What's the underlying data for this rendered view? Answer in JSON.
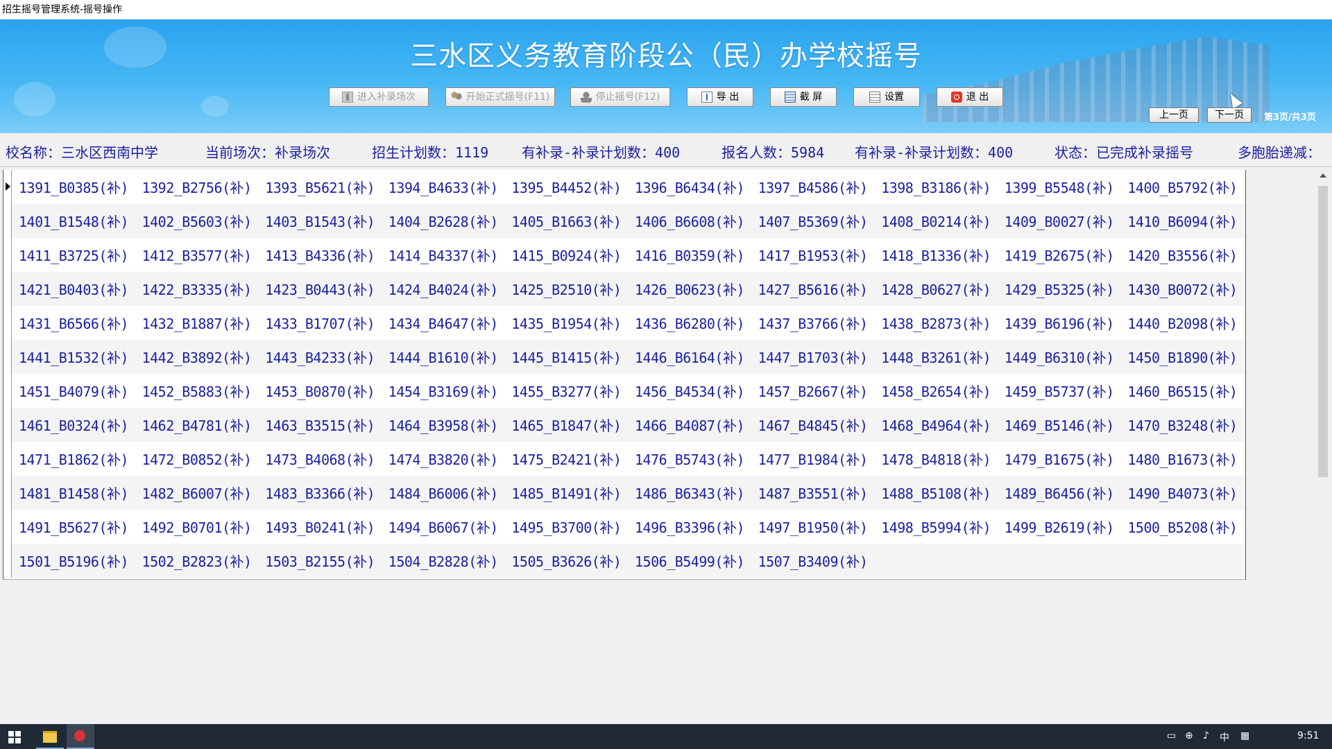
{
  "window": {
    "title": "招生摇号管理系统-摇号操作"
  },
  "header": {
    "title": "三水区义务教育阶段公（民）办学校摇号",
    "buttons": [
      {
        "label": "进入补录场次",
        "icon": "enter-icon",
        "enabled": false
      },
      {
        "label": "开始正式摇号(F11)",
        "icon": "people-icon",
        "enabled": false
      },
      {
        "label": "停止摇号(F12)",
        "icon": "user-stop-icon",
        "enabled": false
      },
      {
        "label": "导 出",
        "icon": "export-icon",
        "enabled": true
      },
      {
        "label": "截 屏",
        "icon": "screenshot-icon",
        "enabled": true
      },
      {
        "label": "设置",
        "icon": "settings-icon",
        "enabled": true
      },
      {
        "label": "退 出",
        "icon": "exit-icon",
        "enabled": true
      }
    ],
    "pager": {
      "prev_label": "上一页",
      "next_label": "下一页",
      "page_info": "第3页/共3页"
    }
  },
  "info": {
    "school": "校名称：三水区西南中学",
    "session": "当前场次：补录场次",
    "plan": "招生计划数：1119",
    "supp_plan": "有补录-补录计划数：400",
    "applicants": "报名人数：5984",
    "supp_plan2": "有补录-补录计划数：400",
    "status": "状态：已完成补录摇号",
    "twins": "多胞胎递减："
  },
  "results": [
    [
      "1391_B0385(补)",
      "1392_B2756(补)",
      "1393_B5621(补)",
      "1394_B4633(补)",
      "1395_B4452(补)",
      "1396_B6434(补)",
      "1397_B4586(补)",
      "1398_B3186(补)",
      "1399_B5548(补)",
      "1400_B5792(补)"
    ],
    [
      "1401_B1548(补)",
      "1402_B5603(补)",
      "1403_B1543(补)",
      "1404_B2628(补)",
      "1405_B1663(补)",
      "1406_B6608(补)",
      "1407_B5369(补)",
      "1408_B0214(补)",
      "1409_B0027(补)",
      "1410_B6094(补)"
    ],
    [
      "1411_B3725(补)",
      "1412_B3577(补)",
      "1413_B4336(补)",
      "1414_B4337(补)",
      "1415_B0924(补)",
      "1416_B0359(补)",
      "1417_B1953(补)",
      "1418_B1336(补)",
      "1419_B2675(补)",
      "1420_B3556(补)"
    ],
    [
      "1421_B0403(补)",
      "1422_B3335(补)",
      "1423_B0443(补)",
      "1424_B4024(补)",
      "1425_B2510(补)",
      "1426_B0623(补)",
      "1427_B5616(补)",
      "1428_B0627(补)",
      "1429_B5325(补)",
      "1430_B0072(补)"
    ],
    [
      "1431_B6566(补)",
      "1432_B1887(补)",
      "1433_B1707(补)",
      "1434_B4647(补)",
      "1435_B1954(补)",
      "1436_B6280(补)",
      "1437_B3766(补)",
      "1438_B2873(补)",
      "1439_B6196(补)",
      "1440_B2098(补)"
    ],
    [
      "1441_B1532(补)",
      "1442_B3892(补)",
      "1443_B4233(补)",
      "1444_B1610(补)",
      "1445_B1415(补)",
      "1446_B6164(补)",
      "1447_B1703(补)",
      "1448_B3261(补)",
      "1449_B6310(补)",
      "1450_B1890(补)"
    ],
    [
      "1451_B4079(补)",
      "1452_B5883(补)",
      "1453_B0870(补)",
      "1454_B3169(补)",
      "1455_B3277(补)",
      "1456_B4534(补)",
      "1457_B2667(补)",
      "1458_B2654(补)",
      "1459_B5737(补)",
      "1460_B6515(补)"
    ],
    [
      "1461_B0324(补)",
      "1462_B4781(补)",
      "1463_B3515(补)",
      "1464_B3958(补)",
      "1465_B1847(补)",
      "1466_B4087(补)",
      "1467_B4845(补)",
      "1468_B4964(补)",
      "1469_B5146(补)",
      "1470_B3248(补)"
    ],
    [
      "1471_B1862(补)",
      "1472_B0852(补)",
      "1473_B4068(补)",
      "1474_B3820(补)",
      "1475_B2421(补)",
      "1476_B5743(补)",
      "1477_B1984(补)",
      "1478_B4818(补)",
      "1479_B1675(补)",
      "1480_B1673(补)"
    ],
    [
      "1481_B1458(补)",
      "1482_B6007(补)",
      "1483_B3366(补)",
      "1484_B6006(补)",
      "1485_B1491(补)",
      "1486_B6343(补)",
      "1487_B3551(补)",
      "1488_B5108(补)",
      "1489_B6456(补)",
      "1490_B4073(补)"
    ],
    [
      "1491_B5627(补)",
      "1492_B0701(补)",
      "1493_B0241(补)",
      "1494_B6067(补)",
      "1495_B3700(补)",
      "1496_B3396(补)",
      "1497_B1950(补)",
      "1498_B5994(补)",
      "1499_B2619(补)",
      "1500_B5208(补)"
    ],
    [
      "1501_B5196(补)",
      "1502_B2823(补)",
      "1503_B2155(补)",
      "1504_B2828(补)",
      "1505_B3626(补)",
      "1506_B5499(补)",
      "1507_B3409(补)"
    ]
  ],
  "taskbar": {
    "ime": "中",
    "time": "9:51"
  },
  "colors": {
    "header": "#2aa3ee",
    "text": "#1a1fa0"
  }
}
